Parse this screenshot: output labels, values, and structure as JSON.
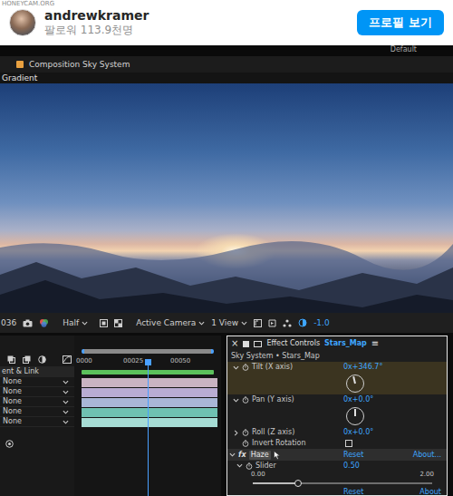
{
  "post": {
    "watermark": "HONEYCAM.ORG",
    "username": "andrewkramer",
    "followers": "팔로워 113.9천명",
    "profile_button": "프로필 보기"
  },
  "workspace": {
    "label": "Default"
  },
  "composition_tab": "Composition Sky System",
  "layer_tab": "Gradient",
  "viewer_toolbar": {
    "frame": "036",
    "resolution": "Half",
    "camera": "Active Camera",
    "views": "1 View",
    "exposure": "-1.0"
  },
  "timeline": {
    "column_header": "ent & Link",
    "ticks": [
      "0000",
      "00025",
      "00050"
    ],
    "playhead": 0.5,
    "layers": [
      {
        "parent": "None",
        "color": "#c9b3c2"
      },
      {
        "parent": "None",
        "color": "#b9acd3"
      },
      {
        "parent": "None",
        "color": "#a9b6d6"
      },
      {
        "parent": "None",
        "color": "#6fc1b1"
      },
      {
        "parent": "None",
        "color": "#a6dcd4"
      }
    ]
  },
  "effect_controls": {
    "close": "×",
    "title": "Effect Controls",
    "layer": "Stars_Map",
    "menu": "≡",
    "breadcrumb": "Sky System • Stars_Map",
    "properties": [
      {
        "kind": "angle",
        "label": "Tilt (X axis)",
        "value": "0x+346.7°",
        "angle": 346.7,
        "expanded": true,
        "selected": true
      },
      {
        "kind": "angle",
        "label": "Pan (Y axis)",
        "value": "0x+0.0°",
        "angle": 0,
        "expanded": true,
        "selected": false
      },
      {
        "kind": "angle",
        "label": "Roll (Z axis)",
        "value": "0x+0.0°",
        "angle": 0,
        "expanded": false,
        "selected": false
      },
      {
        "kind": "checkbox",
        "label": "Invert Rotation",
        "checked": false,
        "selected": false
      }
    ],
    "haze": {
      "fx": "fx",
      "name": "Haze",
      "reset": "Reset",
      "about": "About...",
      "selected": true,
      "expanded": true,
      "slider": {
        "label": "Slider",
        "value": "0.50",
        "min": "0.00",
        "max": "2.00",
        "level": 0.25
      }
    },
    "next_effect": {
      "reset": "Reset",
      "about": "About"
    }
  }
}
